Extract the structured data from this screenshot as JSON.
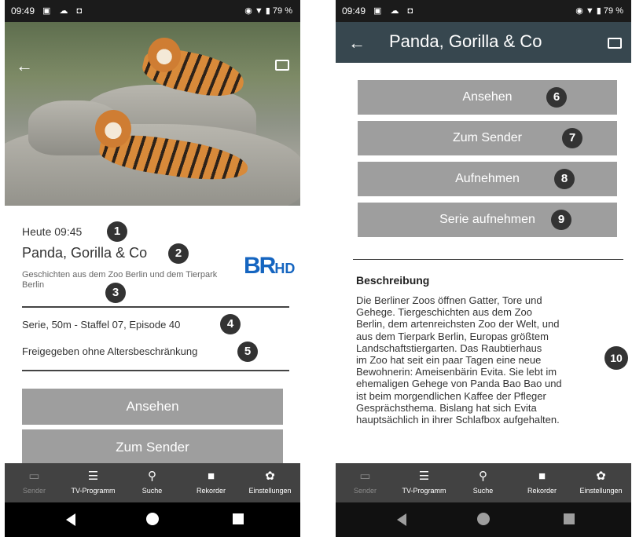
{
  "status_bar": {
    "time": "09:49",
    "battery": "79 %"
  },
  "left_screen": {
    "air_time": "Heute 09:45",
    "title": "Panda, Gorilla & Co",
    "subtitle": "Geschichten aus dem Zoo Berlin und dem Tierpark Berlin",
    "channel_logo": {
      "main": "BR",
      "suffix": "HD"
    },
    "series_info": "Serie, 50m - Staffel 07, Episode 40",
    "age_rating": "Freigegeben ohne Altersbeschränkung",
    "buttons": [
      "Ansehen",
      "Zum Sender"
    ]
  },
  "right_screen": {
    "title": "Panda, Gorilla & Co",
    "buttons": [
      "Ansehen",
      "Zum Sender",
      "Aufnehmen",
      "Serie aufnehmen"
    ],
    "description_heading": "Beschreibung",
    "description_lines": [
      "Die Berliner Zoos öffnen Gatter, Tore und",
      "Gehege. Tiergeschichten aus dem Zoo",
      "Berlin, dem artenreichsten Zoo der Welt, und",
      "aus dem Tierpark Berlin, Europas größtem",
      "Landschaftstiergarten. Das Raubtierhaus",
      "im Zoo hat seit ein paar Tagen eine neue",
      "Bewohnerin: Ameisenbärin Evita. Sie lebt im",
      "ehemaligen Gehege von Panda Bao Bao und",
      "ist beim morgendlichen Kaffee der Pfleger",
      "Gesprächsthema. Bislang hat sich Evita",
      "hauptsächlich in ihrer Schlafbox aufgehalten."
    ]
  },
  "bottom_nav": [
    {
      "label": "Sender",
      "icon": "tv-icon"
    },
    {
      "label": "TV-Programm",
      "icon": "list-icon"
    },
    {
      "label": "Suche",
      "icon": "search-icon"
    },
    {
      "label": "Rekorder",
      "icon": "camera-icon"
    },
    {
      "label": "Einstellungen",
      "icon": "gear-icon"
    }
  ],
  "annotation_badges": [
    "1",
    "2",
    "3",
    "4",
    "5",
    "6",
    "7",
    "8",
    "9",
    "10"
  ],
  "colors": {
    "button": "#9e9e9e",
    "nav": "#424242",
    "appbar": "#37474f",
    "brand": "#1565c0"
  }
}
